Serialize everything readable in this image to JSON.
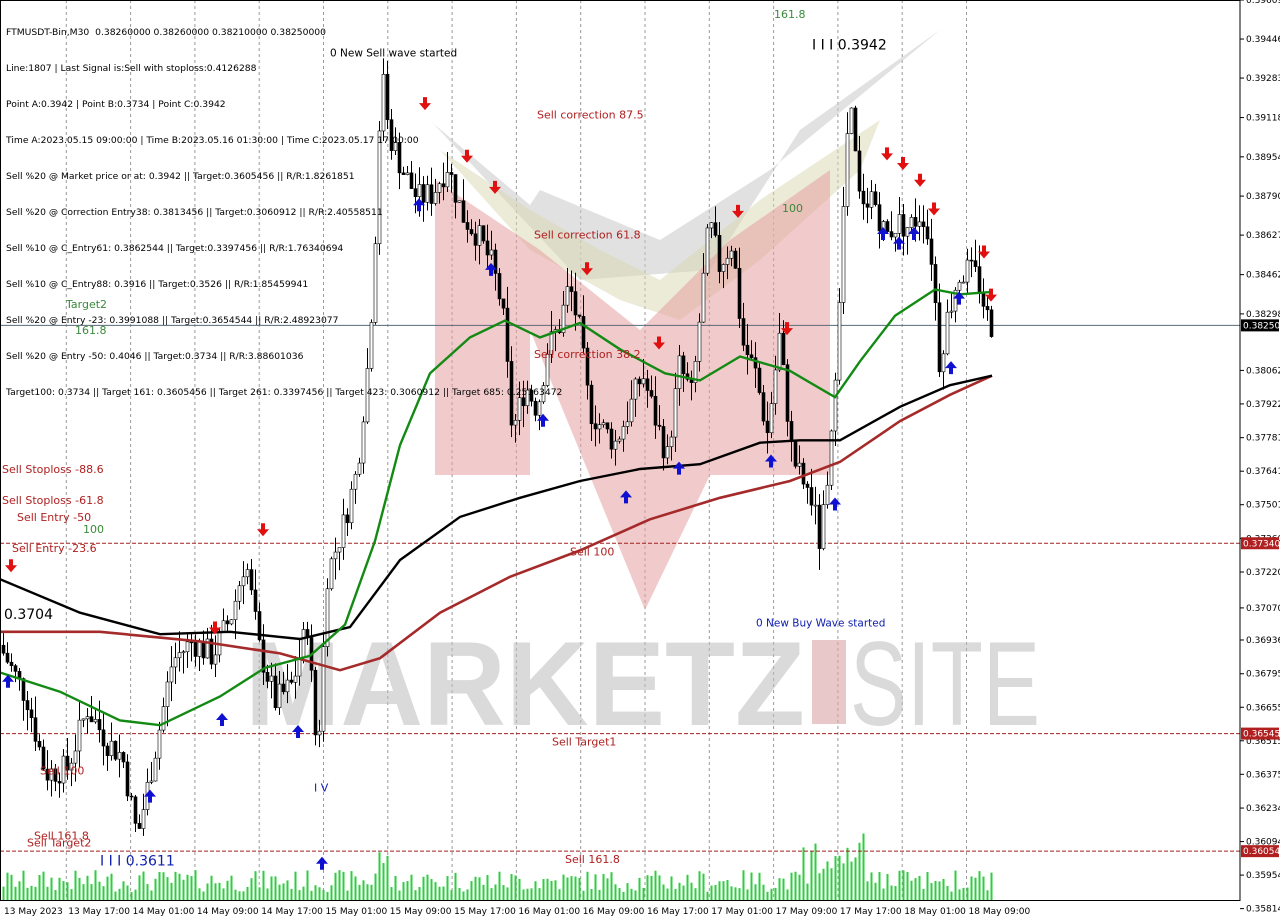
{
  "info_lines": [
    "FTMUSDT-Bin,M30  0.38260000 0.38260000 0.38210000 0.38250000",
    "Line:1807 | Last Signal is:Sell with stoploss:0.4126288",
    "Point A:0.3942 | Point B:0.3734 | Point C:0.3942",
    "Time A:2023.05.15 09:00:00 | Time B:2023.05.16 01:30:00 | Time C:2023.05.17 17:00:00",
    "Sell %20 @ Market price or at: 0.3942 || Target:0.3605456 || R/R:1.8261851",
    "Sell %20 @ Correction Entry38: 0.3813456 || Target:0.3060912 || R/R:2.40558511",
    "Sell %10 @ C_Entry61: 0.3862544 || Target:0.3397456 || R/R:1.76340694",
    "Sell %10 @ C_Entry88: 0.3916 || Target:0.3526 || R/R:1.85459941",
    "Sell %20 @ Entry -23: 0.3991088 || Target:0.3654544 || R/R:2.48923077",
    "Sell %20 @ Entry -50: 0.4046 || Target:0.3734 || R/R:3.88601036",
    "Target100: 0.3734 || Target 161: 0.3605456 || Target 261: 0.3397456 || Target 423: 0.3060912 || Target 685: 0.25163472"
  ],
  "watermark": {
    "left": "MARKETZ",
    "right": "SITE"
  },
  "colors": {
    "green": "#1a8a1a",
    "black": "#000000",
    "red": "#b03030",
    "up": "#1010d0",
    "down": "#e01010",
    "level_line": "#a02020",
    "label_red": "#b02020",
    "label_green": "#3a8a3a"
  },
  "chart_data": {
    "type": "candlestick",
    "symbol": "FTMUSDT-Bin",
    "timeframe": "M30",
    "ylim": [
      0.3585,
      0.39609
    ],
    "y_ticks": [
      "0.39609",
      "0.39446",
      "0.39283",
      "0.39118",
      "0.38954",
      "0.38790",
      "0.38627",
      "0.38462",
      "0.38298",
      "0.38062",
      "0.37922",
      "0.37781",
      "0.37641",
      "0.37501",
      "0.37360",
      "0.37220",
      "0.37070",
      "0.36936",
      "0.36795",
      "0.36655",
      "0.36515",
      "0.36375",
      "0.36234",
      "0.36094",
      "0.35954",
      "0.35814"
    ],
    "x_labels": [
      "13 May 2023",
      "13 May 17:00",
      "14 May 01:00",
      "14 May 09:00",
      "14 May 17:00",
      "15 May 01:00",
      "15 May 09:00",
      "15 May 17:00",
      "16 May 01:00",
      "16 May 09:00",
      "16 May 17:00",
      "17 May 01:00",
      "17 May 09:00",
      "17 May 17:00",
      "18 May 01:00",
      "18 May 09:00"
    ],
    "current_price": "0.38250",
    "price_markers": [
      {
        "value": 0.3734,
        "text": "0.37340"
      },
      {
        "value": 0.36545,
        "text": "0.36545"
      },
      {
        "value": 0.36054,
        "text": "0.36054"
      }
    ],
    "levels": [
      {
        "value": 0.3734,
        "label": "Sell 100"
      },
      {
        "value": 0.36545,
        "label": "Sell Target1"
      },
      {
        "value": 0.36054,
        "label": "Sell 161.8"
      }
    ],
    "labels": [
      {
        "text": "0 New Sell wave started",
        "value": 0.3939,
        "color": "black"
      },
      {
        "text": "I I I 0.3942",
        "value": 0.3942,
        "color": "black"
      },
      {
        "text": "161.8",
        "value": 0.3955,
        "color": "green"
      },
      {
        "text": "Sell correction 87.5",
        "value": 0.3913,
        "color": "red"
      },
      {
        "text": "Sell correction 61.8",
        "value": 0.3863,
        "color": "red"
      },
      {
        "text": "Sell correction 38.2",
        "value": 0.3813,
        "color": "red"
      },
      {
        "text": "100",
        "value": 0.3874,
        "color": "green"
      },
      {
        "text": "Target2",
        "value": 0.3834,
        "color": "green"
      },
      {
        "text": "161.8",
        "value": 0.3823,
        "color": "green"
      },
      {
        "text": "Sell Stoploss -88.6",
        "value": 0.3765,
        "color": "red"
      },
      {
        "text": "Sell Stoploss -61.8",
        "value": 0.3752,
        "color": "red"
      },
      {
        "text": "Sell Entry -50",
        "value": 0.3745,
        "color": "red"
      },
      {
        "text": "100",
        "value": 0.374,
        "color": "green"
      },
      {
        "text": "Sell Entry -23.6",
        "value": 0.3732,
        "color": "red"
      },
      {
        "text": "0.3704",
        "value": 0.3704,
        "color": "black"
      },
      {
        "text": "0 New Buy Wave started",
        "value": 0.3701,
        "color": "blue"
      },
      {
        "text": "Sell 100",
        "value": 0.3639,
        "color": "red"
      },
      {
        "text": "Sell 161.8",
        "value": 0.3612,
        "color": "red"
      },
      {
        "text": "Sell Target2",
        "value": 0.3609,
        "color": "red"
      },
      {
        "text": "I I I 0.3611",
        "value": 0.3601,
        "color": "blue"
      },
      {
        "text": "I V",
        "value": 0.3632,
        "color": "blue"
      }
    ],
    "anchors": [
      {
        "x": 0,
        "y": 0.3693
      },
      {
        "x": 30,
        "y": 0.3669
      },
      {
        "x": 48,
        "y": 0.3638
      },
      {
        "x": 70,
        "y": 0.364
      },
      {
        "x": 90,
        "y": 0.3665
      },
      {
        "x": 110,
        "y": 0.3651
      },
      {
        "x": 125,
        "y": 0.3645
      },
      {
        "x": 140,
        "y": 0.3611
      },
      {
        "x": 158,
        "y": 0.3648
      },
      {
        "x": 175,
        "y": 0.3685
      },
      {
        "x": 195,
        "y": 0.3693
      },
      {
        "x": 215,
        "y": 0.3687
      },
      {
        "x": 235,
        "y": 0.3705
      },
      {
        "x": 248,
        "y": 0.3728
      },
      {
        "x": 262,
        "y": 0.369
      },
      {
        "x": 278,
        "y": 0.3668
      },
      {
        "x": 295,
        "y": 0.3675
      },
      {
        "x": 310,
        "y": 0.37
      },
      {
        "x": 320,
        "y": 0.3643
      },
      {
        "x": 330,
        "y": 0.3721
      },
      {
        "x": 345,
        "y": 0.374
      },
      {
        "x": 360,
        "y": 0.3765
      },
      {
        "x": 372,
        "y": 0.3815
      },
      {
        "x": 380,
        "y": 0.388
      },
      {
        "x": 385,
        "y": 0.3936
      },
      {
        "x": 392,
        "y": 0.3905
      },
      {
        "x": 405,
        "y": 0.389
      },
      {
        "x": 420,
        "y": 0.3878
      },
      {
        "x": 435,
        "y": 0.388
      },
      {
        "x": 450,
        "y": 0.3892
      },
      {
        "x": 465,
        "y": 0.3871
      },
      {
        "x": 480,
        "y": 0.3863
      },
      {
        "x": 495,
        "y": 0.385
      },
      {
        "x": 505,
        "y": 0.3832
      },
      {
        "x": 515,
        "y": 0.378
      },
      {
        "x": 528,
        "y": 0.38
      },
      {
        "x": 540,
        "y": 0.379
      },
      {
        "x": 550,
        "y": 0.3815
      },
      {
        "x": 562,
        "y": 0.3825
      },
      {
        "x": 572,
        "y": 0.3842
      },
      {
        "x": 582,
        "y": 0.3823
      },
      {
        "x": 592,
        "y": 0.379
      },
      {
        "x": 605,
        "y": 0.3782
      },
      {
        "x": 618,
        "y": 0.3776
      },
      {
        "x": 632,
        "y": 0.379
      },
      {
        "x": 645,
        "y": 0.3805
      },
      {
        "x": 658,
        "y": 0.3786
      },
      {
        "x": 670,
        "y": 0.377
      },
      {
        "x": 682,
        "y": 0.3808
      },
      {
        "x": 695,
        "y": 0.3795
      },
      {
        "x": 705,
        "y": 0.384
      },
      {
        "x": 712,
        "y": 0.3868
      },
      {
        "x": 722,
        "y": 0.385
      },
      {
        "x": 735,
        "y": 0.386
      },
      {
        "x": 745,
        "y": 0.3818
      },
      {
        "x": 758,
        "y": 0.3805
      },
      {
        "x": 770,
        "y": 0.378
      },
      {
        "x": 782,
        "y": 0.382
      },
      {
        "x": 795,
        "y": 0.377
      },
      {
        "x": 805,
        "y": 0.376
      },
      {
        "x": 815,
        "y": 0.3752
      },
      {
        "x": 822,
        "y": 0.3735
      },
      {
        "x": 832,
        "y": 0.376
      },
      {
        "x": 842,
        "y": 0.384
      },
      {
        "x": 852,
        "y": 0.392
      },
      {
        "x": 862,
        "y": 0.3878
      },
      {
        "x": 875,
        "y": 0.388
      },
      {
        "x": 888,
        "y": 0.3862
      },
      {
        "x": 900,
        "y": 0.3868
      },
      {
        "x": 912,
        "y": 0.3866
      },
      {
        "x": 925,
        "y": 0.3873
      },
      {
        "x": 935,
        "y": 0.3852
      },
      {
        "x": 942,
        "y": 0.381
      },
      {
        "x": 950,
        "y": 0.3828
      },
      {
        "x": 960,
        "y": 0.3845
      },
      {
        "x": 970,
        "y": 0.3848
      },
      {
        "x": 980,
        "y": 0.3845
      },
      {
        "x": 992,
        "y": 0.3825
      }
    ],
    "ma_green": [
      {
        "x": 0,
        "y": 0.368
      },
      {
        "x": 60,
        "y": 0.3672
      },
      {
        "x": 120,
        "y": 0.366
      },
      {
        "x": 160,
        "y": 0.3658
      },
      {
        "x": 220,
        "y": 0.367
      },
      {
        "x": 265,
        "y": 0.3682
      },
      {
        "x": 310,
        "y": 0.3687
      },
      {
        "x": 345,
        "y": 0.37
      },
      {
        "x": 375,
        "y": 0.3735
      },
      {
        "x": 400,
        "y": 0.3775
      },
      {
        "x": 430,
        "y": 0.3805
      },
      {
        "x": 470,
        "y": 0.382
      },
      {
        "x": 505,
        "y": 0.3827
      },
      {
        "x": 540,
        "y": 0.382
      },
      {
        "x": 580,
        "y": 0.3826
      },
      {
        "x": 620,
        "y": 0.3815
      },
      {
        "x": 665,
        "y": 0.3805
      },
      {
        "x": 700,
        "y": 0.3802
      },
      {
        "x": 740,
        "y": 0.3812
      },
      {
        "x": 790,
        "y": 0.3806
      },
      {
        "x": 835,
        "y": 0.3795
      },
      {
        "x": 860,
        "y": 0.381
      },
      {
        "x": 895,
        "y": 0.3829
      },
      {
        "x": 935,
        "y": 0.384
      },
      {
        "x": 960,
        "y": 0.3838
      },
      {
        "x": 992,
        "y": 0.3839
      }
    ],
    "ma_black": [
      {
        "x": 0,
        "y": 0.3719
      },
      {
        "x": 80,
        "y": 0.3705
      },
      {
        "x": 160,
        "y": 0.3696
      },
      {
        "x": 230,
        "y": 0.3697
      },
      {
        "x": 300,
        "y": 0.3694
      },
      {
        "x": 350,
        "y": 0.3699
      },
      {
        "x": 400,
        "y": 0.3727
      },
      {
        "x": 460,
        "y": 0.3745
      },
      {
        "x": 520,
        "y": 0.3753
      },
      {
        "x": 580,
        "y": 0.376
      },
      {
        "x": 640,
        "y": 0.3765
      },
      {
        "x": 700,
        "y": 0.3767
      },
      {
        "x": 760,
        "y": 0.3776
      },
      {
        "x": 800,
        "y": 0.3777
      },
      {
        "x": 840,
        "y": 0.3777
      },
      {
        "x": 900,
        "y": 0.3791
      },
      {
        "x": 950,
        "y": 0.38
      },
      {
        "x": 992,
        "y": 0.3804
      }
    ],
    "ma_red": [
      {
        "x": 0,
        "y": 0.3697
      },
      {
        "x": 100,
        "y": 0.3697
      },
      {
        "x": 200,
        "y": 0.3693
      },
      {
        "x": 280,
        "y": 0.3688
      },
      {
        "x": 340,
        "y": 0.3681
      },
      {
        "x": 380,
        "y": 0.3686
      },
      {
        "x": 440,
        "y": 0.3705
      },
      {
        "x": 510,
        "y": 0.372
      },
      {
        "x": 580,
        "y": 0.3731
      },
      {
        "x": 650,
        "y": 0.3744
      },
      {
        "x": 720,
        "y": 0.3753
      },
      {
        "x": 790,
        "y": 0.376
      },
      {
        "x": 840,
        "y": 0.3768
      },
      {
        "x": 900,
        "y": 0.3785
      },
      {
        "x": 950,
        "y": 0.3796
      },
      {
        "x": 992,
        "y": 0.3804
      }
    ],
    "arrows_down": [
      {
        "x": 11,
        "y": 0.3724
      },
      {
        "x": 215,
        "y": 0.3698
      },
      {
        "x": 263,
        "y": 0.3739
      },
      {
        "x": 425,
        "y": 0.3917
      },
      {
        "x": 467,
        "y": 0.3895
      },
      {
        "x": 495,
        "y": 0.3882
      },
      {
        "x": 587,
        "y": 0.3848
      },
      {
        "x": 659,
        "y": 0.3817
      },
      {
        "x": 738,
        "y": 0.3872
      },
      {
        "x": 787,
        "y": 0.3823
      },
      {
        "x": 887,
        "y": 0.3896
      },
      {
        "x": 903,
        "y": 0.3892
      },
      {
        "x": 920,
        "y": 0.3885
      },
      {
        "x": 934,
        "y": 0.3873
      },
      {
        "x": 984,
        "y": 0.3855
      },
      {
        "x": 991,
        "y": 0.3837
      }
    ],
    "arrows_up": [
      {
        "x": 8,
        "y": 0.3677
      },
      {
        "x": 150,
        "y": 0.3629
      },
      {
        "x": 222,
        "y": 0.3661
      },
      {
        "x": 298,
        "y": 0.3656
      },
      {
        "x": 322,
        "y": 0.3601
      },
      {
        "x": 419,
        "y": 0.3876
      },
      {
        "x": 491,
        "y": 0.3849
      },
      {
        "x": 543,
        "y": 0.3786
      },
      {
        "x": 626,
        "y": 0.3754
      },
      {
        "x": 679,
        "y": 0.3766
      },
      {
        "x": 771,
        "y": 0.3769
      },
      {
        "x": 835,
        "y": 0.3751
      },
      {
        "x": 883,
        "y": 0.3864
      },
      {
        "x": 899,
        "y": 0.386
      },
      {
        "x": 914,
        "y": 0.3864
      },
      {
        "x": 951,
        "y": 0.3808
      },
      {
        "x": 959,
        "y": 0.3837
      }
    ]
  }
}
